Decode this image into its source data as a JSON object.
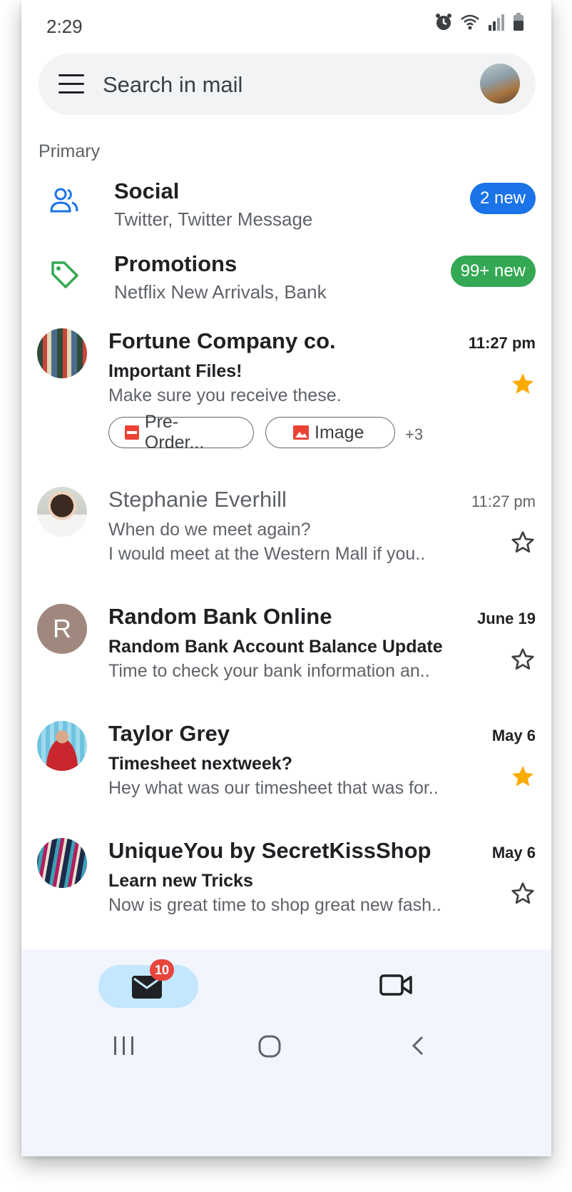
{
  "status_bar": {
    "time": "2:29"
  },
  "search": {
    "placeholder": "Search in mail"
  },
  "section_label": "Primary",
  "categories": [
    {
      "title": "Social",
      "subtitle": "Twitter, Twitter Message",
      "badge": "2 new",
      "badge_color": "#1a73e8",
      "icon": "people-icon"
    },
    {
      "title": "Promotions",
      "subtitle": "Netflix New Arrivals, Bank",
      "badge": "99+ new",
      "badge_color": "#34a853",
      "icon": "tag-icon"
    }
  ],
  "emails": [
    {
      "sender": "Fortune Company co.",
      "date": "11:27 pm",
      "subject": "Important Files!",
      "snippet": "Make sure you receive these.",
      "starred": true,
      "unread": true,
      "attachments": [
        {
          "type": "pdf-icon",
          "label": "Pre-Order..."
        },
        {
          "type": "image-icon",
          "label": "Image"
        }
      ],
      "more_attachments": "+3"
    },
    {
      "sender": "Stephanie Everhill",
      "date": "11:27 pm",
      "subject": "When do we meet again?",
      "snippet": "I would meet at the Western Mall if you..",
      "starred": false,
      "unread": false
    },
    {
      "sender": "Random Bank Online",
      "date": "June 19",
      "subject": "Random Bank Account Balance Update",
      "snippet": "Time to check your bank information an..",
      "starred": false,
      "unread": true,
      "avatar_letter": "R"
    },
    {
      "sender": "Taylor Grey",
      "date": "May 6",
      "subject": "Timesheet nextweek?",
      "snippet": "Hey what was our timesheet that was for..",
      "starred": true,
      "unread": true
    },
    {
      "sender": "UniqueYou by SecretKissShop",
      "date": "May 6",
      "subject": "Learn new Tricks",
      "snippet": "Now is great time to shop great new fash..",
      "starred": false,
      "unread": true
    }
  ],
  "bottom_nav": {
    "mail_badge": "10"
  },
  "colors": {
    "star_active": "#f9ab00",
    "accent_blue": "#1a73e8",
    "accent_green": "#34a853",
    "mail_pill": "#c2e7ff",
    "badge_red": "#e8453c"
  }
}
